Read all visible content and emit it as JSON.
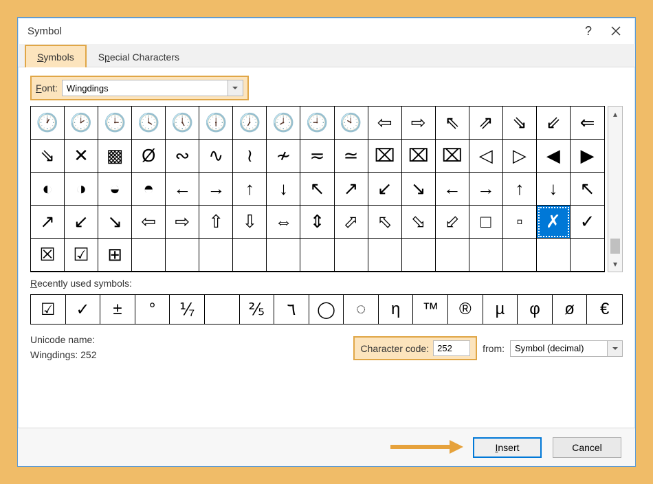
{
  "dialog": {
    "title": "Symbol"
  },
  "tabs": {
    "symbols": "Symbols",
    "special": "Special Characters"
  },
  "font": {
    "label": "Font:",
    "value": "Wingdings"
  },
  "grid": {
    "selected_index": 66,
    "cells": [
      "🕐",
      "🕑",
      "🕒",
      "🕓",
      "🕔",
      "🕕",
      "🕖",
      "🕗",
      "🕘",
      "🕙",
      "⇦",
      "⇨",
      "⇖",
      "⇗",
      "⇘",
      "⇙",
      "⇐",
      "⇘",
      "✕",
      "▩",
      "Ø",
      "∾",
      "∿",
      "≀",
      "≁",
      "≂",
      "≃",
      "⌧",
      "⌧",
      "⌧",
      "◁",
      "▷",
      "◀",
      "▶",
      "◐",
      "◑",
      "◒",
      "◓",
      "←",
      "→",
      "↑",
      "↓",
      "↖",
      "↗",
      "↙",
      "↘",
      "←",
      "→",
      "↑",
      "↓",
      "↖",
      "↗",
      "↙",
      "↘",
      "⇦",
      "⇨",
      "⇧",
      "⇩",
      "⇔",
      "⇕",
      "⬀",
      "⬁",
      "⬂",
      "⬃",
      "□",
      "▫",
      "✗",
      "✓",
      "☒",
      "☑",
      "⊞",
      "",
      "",
      "",
      "",
      "",
      "",
      "",
      "",
      "",
      "",
      "",
      "",
      "",
      ""
    ]
  },
  "recent": {
    "label": "Recently used symbols:",
    "cells": [
      "☑",
      "✓",
      "±",
      "°",
      "⅟₇",
      "",
      "⅖",
      "٦",
      "◯",
      "◌",
      "η",
      "™",
      "®",
      "µ",
      "φ",
      "ø",
      "€"
    ]
  },
  "unicode": {
    "name_label": "Unicode name:",
    "name_value": "Wingdings: 252"
  },
  "charcode": {
    "label": "Character code:",
    "value": "252"
  },
  "from": {
    "label": "from:",
    "value": "Symbol (decimal)"
  },
  "buttons": {
    "insert": "Insert",
    "cancel": "Cancel"
  }
}
